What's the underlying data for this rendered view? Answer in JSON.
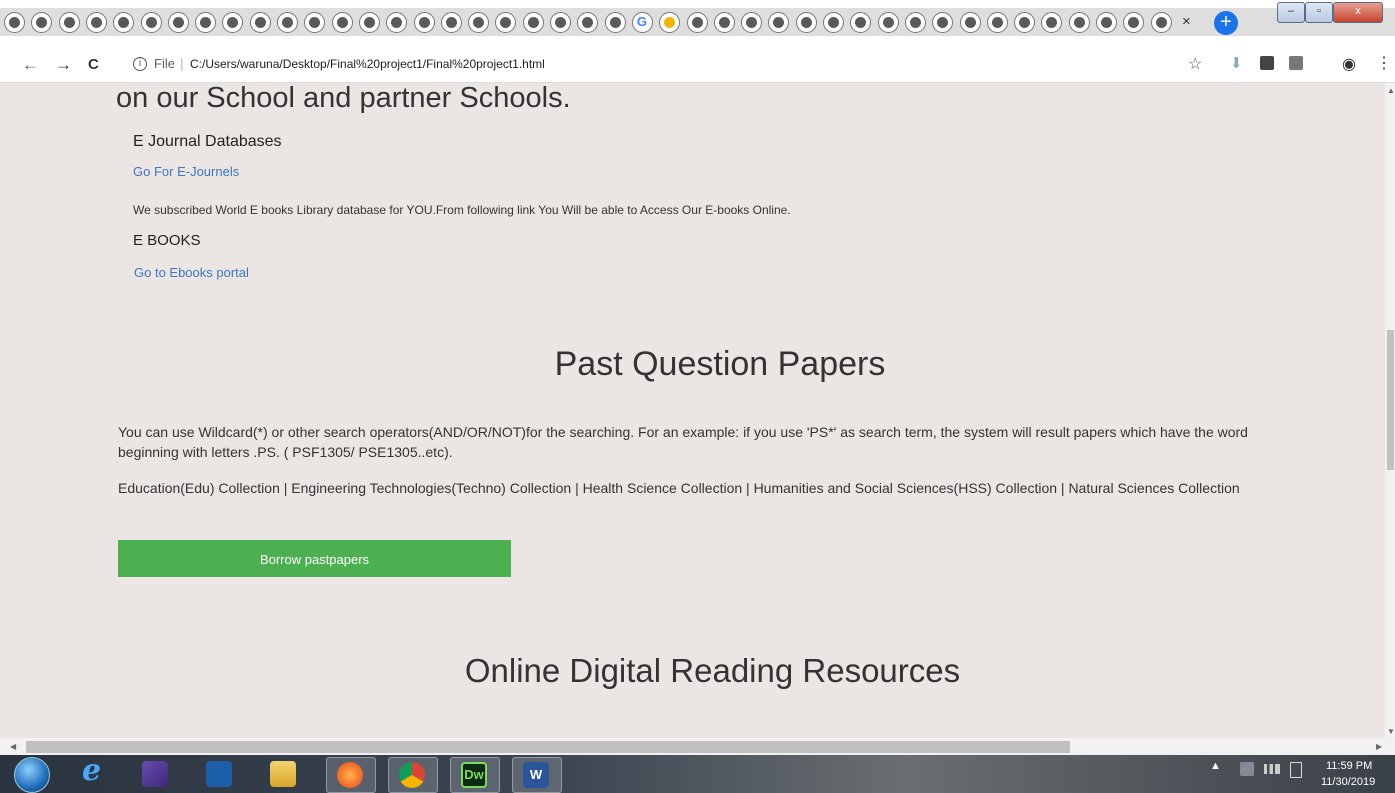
{
  "browser": {
    "tab_close": "×",
    "new_tab": "+",
    "window_controls": {
      "minimize": "–",
      "maximize": "▫",
      "close": "x"
    },
    "nav": {
      "back": "←",
      "forward": "→",
      "reload": "C"
    },
    "url_prefix": "File",
    "url_separator": "|",
    "url": "C:/Users/waruna/Desktop/Final%20project1/Final%20project1.html",
    "icons": [
      "info-icon",
      "star-icon",
      "download-icon",
      "extension-icon",
      "profile-icon",
      "menu-icon"
    ]
  },
  "page": {
    "heading_top": "on our School and partner Schools.",
    "ejournal": {
      "heading": "E Journal Databases",
      "link": "Go For E-Journels"
    },
    "ebook_note": "We subscribed World E books Library database for YOU.From following link You Will be able to Access Our E-books Online.",
    "ebooks": {
      "heading": "E BOOKS",
      "link": "Go to Ebooks portal"
    },
    "past_papers": {
      "heading": "Past Question Papers",
      "help": "You can use Wildcard(*) or other search operators(AND/OR/NOT)for the searching. For an example: if you use 'PS*' as search term, the system will result papers which have the word beginning with letters .PS. ( PSF1305/ PSE1305..etc).",
      "collections": "Education(Edu) Collection | Engineering Technologies(Techno) Collection | Health Science Collection | Humanities and Social Sciences(HSS) Collection | Natural Sciences Collection",
      "button": "Borrow pastpapers"
    },
    "online_resources_heading": "Online Digital Reading Resources"
  },
  "taskbar": {
    "apps": [
      "windows-start",
      "internet-explorer",
      "visual-studio",
      "media-player",
      "file-explorer",
      "firefox",
      "chrome",
      "dreamweaver",
      "word"
    ],
    "dw_label": "Dw",
    "word_label": "W",
    "tray_arrow": "▲",
    "time": "11:59 PM",
    "date": "11/30/2019"
  },
  "colors": {
    "page_bg": "#ebe6e4",
    "link": "#3d76c0",
    "button_green": "#4caf50"
  }
}
